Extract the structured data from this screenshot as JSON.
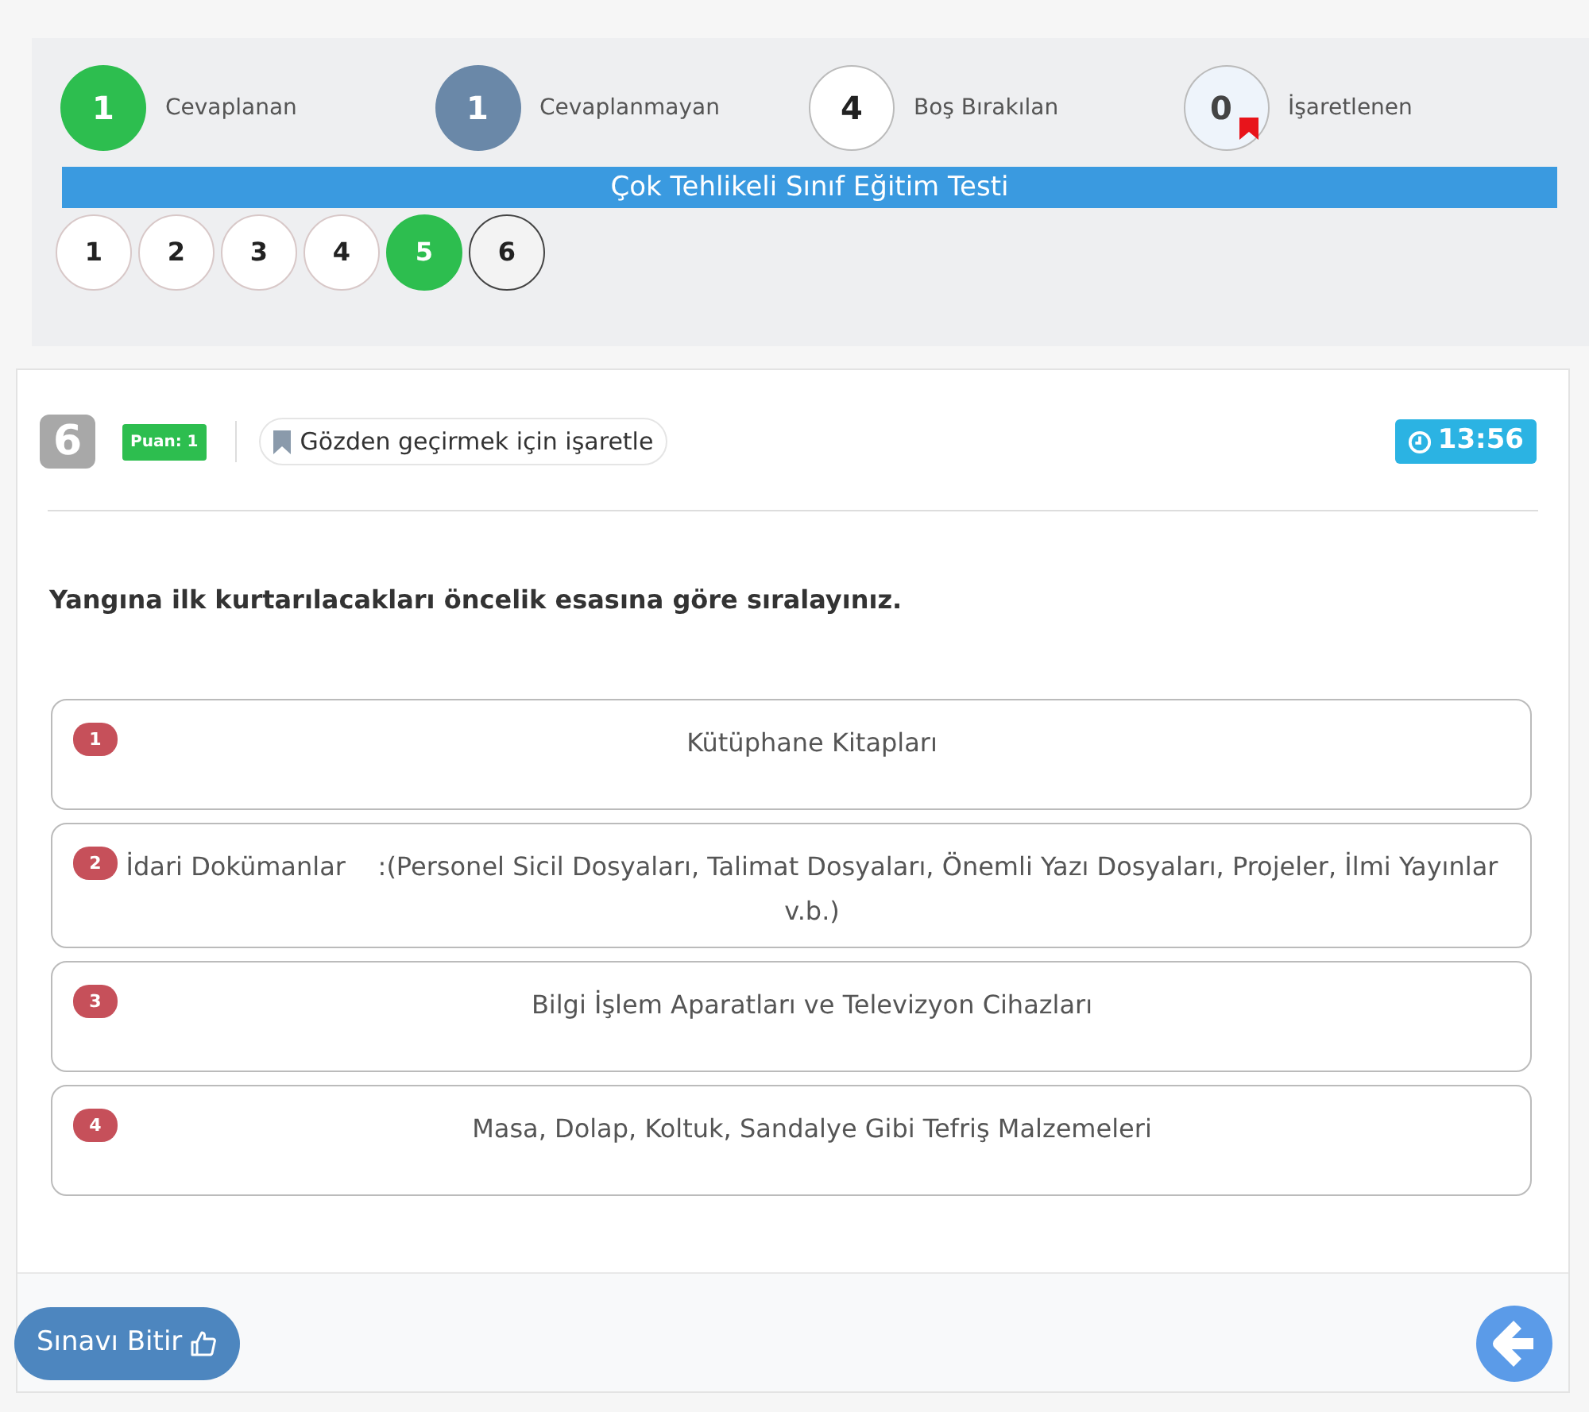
{
  "stats": [
    {
      "count": "1",
      "label": "Cevaplanan",
      "kind": "answered"
    },
    {
      "count": "1",
      "label": "Cevaplanmayan",
      "kind": "unanswered"
    },
    {
      "count": "4",
      "label": "Boş Bırakılan",
      "kind": "blank"
    },
    {
      "count": "0",
      "label": "İşaretlenen",
      "kind": "marked"
    }
  ],
  "test_title": "Çok Tehlikeli Sınıf Eğitim Testi",
  "questions": [
    {
      "number": "1",
      "kind": "blank"
    },
    {
      "number": "2",
      "kind": "blank"
    },
    {
      "number": "3",
      "kind": "blank"
    },
    {
      "number": "4",
      "kind": "blank"
    },
    {
      "number": "5",
      "kind": "answered"
    },
    {
      "number": "6",
      "kind": "current"
    }
  ],
  "question": {
    "number": "6",
    "score": "Puan: 1",
    "mark_button": "Gözden geçirmek için işaretle",
    "timer": "13:56",
    "text": "Yangına ilk kurtarılacakları öncelik esasına göre sıralayınız."
  },
  "options": [
    {
      "index": "1",
      "text": "Kütüphane Kitapları"
    },
    {
      "index": "2",
      "text": "İdari Dokümanlar    :(Personel Sicil Dosyaları, Talimat Dosyaları, Önemli Yazı Dosyaları, Projeler, İlmi Yayınlar  v.b.)"
    },
    {
      "index": "3",
      "text": "Bilgi İşlem Aparatları ve Televizyon Cihazları"
    },
    {
      "index": "4",
      "text": "Masa, Dolap, Koltuk, Sandalye Gibi Tefriş Malzemeleri"
    }
  ],
  "finish_button": "Sınavı Bitir"
}
